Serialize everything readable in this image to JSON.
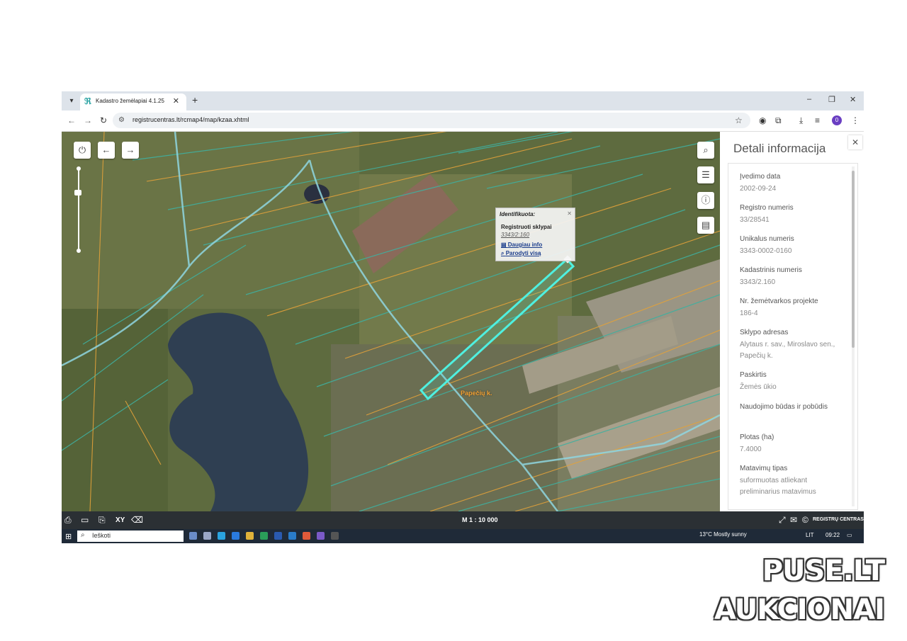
{
  "browser": {
    "tab_title": "Kadastro žemėlapiai 4.1.25",
    "new_tab": "+",
    "close_tab": "✕",
    "url": "registrucentras.lt/rcmap4/map/kzaa.xhtml"
  },
  "map": {
    "popup": {
      "header": "Identifikuota:",
      "title": "Registruoti sklypai",
      "id": "3343/2:160",
      "more_info": "Daugiau info",
      "show_all": "Parodyti visą"
    },
    "place_label": "Papečių k.",
    "scale": "M 1 : 10 000",
    "brand": "REGISTRŲ CENTRAS"
  },
  "panel": {
    "title": "Detali informacija",
    "fields": [
      {
        "label": "Įvedimo data",
        "value": "2002-09-24"
      },
      {
        "label": "Registro numeris",
        "value": "33/28541"
      },
      {
        "label": "Unikalus numeris",
        "value": "3343-0002-0160"
      },
      {
        "label": "Kadastrinis numeris",
        "value": "3343/2.160"
      },
      {
        "label": "Nr. žemėtvarkos projekte",
        "value": "186-4"
      },
      {
        "label": "Sklypo adresas",
        "value": "Alytaus r. sav., Miroslavo sen., Papečių k."
      },
      {
        "label": "Paskirtis",
        "value": "Žemės ūkio"
      },
      {
        "label": "Naudojimo būdas ir pobūdis",
        "value": ""
      },
      {
        "label": "Plotas (ha)",
        "value": "7.4000"
      },
      {
        "label": "Matavimų tipas",
        "value": "suformuotas atliekant preliminarius matavimus"
      }
    ]
  },
  "toolbar": {
    "xy_label": "XY"
  },
  "taskbar": {
    "search_placeholder": "Ieškoti",
    "weather": "13°C  Mostly sunny",
    "lang": "LIT",
    "time": "09:22"
  },
  "watermark": {
    "line1": "PUSE.LT",
    "line2": "AUKCIONAI"
  }
}
